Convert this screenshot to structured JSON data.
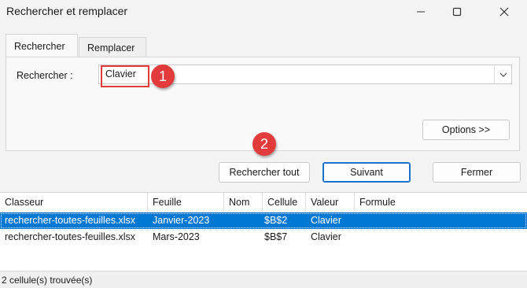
{
  "window": {
    "title": "Rechercher et remplacer",
    "minimize_icon": "minimize-icon",
    "maximize_icon": "maximize-icon",
    "close_icon": "close-icon"
  },
  "tabs": [
    {
      "label": "Rechercher",
      "active": true
    },
    {
      "label": "Remplacer",
      "active": false
    }
  ],
  "find": {
    "label": "Rechercher :",
    "value": "Clavier"
  },
  "buttons": {
    "options": "Options >>",
    "find_all": "Rechercher tout",
    "find_next": "Suivant",
    "close": "Fermer"
  },
  "annotations": {
    "badge1": "1",
    "badge2": "2",
    "color": "#e23b3b"
  },
  "results": {
    "columns": [
      "Classeur",
      "Feuille",
      "Nom",
      "Cellule",
      "Valeur",
      "Formule"
    ],
    "rows": [
      {
        "classeur": "rechercher-toutes-feuilles.xlsx",
        "feuille": "Janvier-2023",
        "nom": "",
        "cellule": "$B$2",
        "valeur": "Clavier",
        "formule": "",
        "selected": true
      },
      {
        "classeur": "rechercher-toutes-feuilles.xlsx",
        "feuille": "Mars-2023",
        "nom": "",
        "cellule": "$B$7",
        "valeur": "Clavier",
        "formule": "",
        "selected": false
      }
    ]
  },
  "status": "2 cellule(s) trouvée(s)",
  "colors": {
    "selection": "#0078d4",
    "primary_border": "#1a73c9"
  }
}
